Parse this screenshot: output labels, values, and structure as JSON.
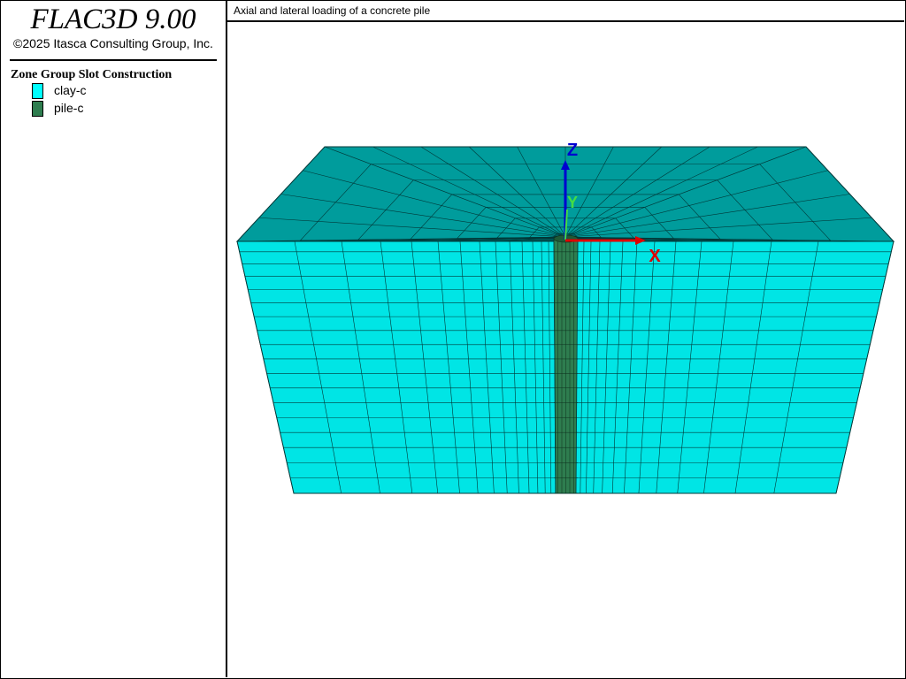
{
  "app": {
    "title": "FLAC3D 9.00",
    "copyright": "©2025 Itasca Consulting Group, Inc."
  },
  "legend": {
    "title": "Zone Group Slot Construction",
    "items": [
      {
        "label": "clay-c",
        "color": "#00ffff"
      },
      {
        "label": "pile-c",
        "color": "#2e7d4f"
      }
    ]
  },
  "plot": {
    "title": "Axial and lateral loading of a concrete pile"
  },
  "axes": {
    "x_label": "X",
    "y_label": "Y",
    "z_label": "Z",
    "x_color": "#e00000",
    "y_color": "#44dd44",
    "z_color": "#0000d0"
  },
  "colors": {
    "clay_front": "#00e5e5",
    "clay_top": "#009c9c",
    "pile": "#2e7d4f",
    "mesh_line": "#003838"
  }
}
